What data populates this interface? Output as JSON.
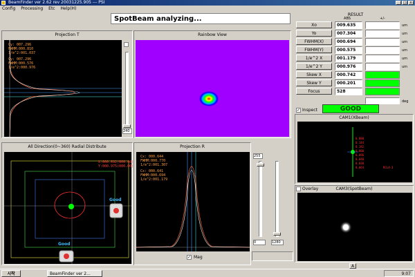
{
  "window": {
    "title": "BeamFinder ver 2.62 rev 20031225.905 --- PSI"
  },
  "menu": [
    "Config",
    "Processing",
    "Etc",
    "Help(H)"
  ],
  "status": "SpotBeam analyzing...",
  "projection_t": {
    "title": "Projection T",
    "readout": [
      "Cy:    007.296",
      "FWHM:000.810",
      "1/e^2:001.037",
      "Cy:    007.296",
      "FWHM:000.576",
      "1/e^2:000.976"
    ],
    "slider_value": "240"
  },
  "rainbow": {
    "title": "Rainbow View"
  },
  "radial": {
    "title": "All Direction(0~360) Radial Distribute",
    "readout": [
      "X:000.692(000.00)",
      "Y:000.975(000.00)"
    ],
    "good_1": "Good",
    "good_2": "Good"
  },
  "projection_r": {
    "title": "Projection R",
    "readout": [
      "Cx:    000.644",
      "FWHM:000.770",
      "1/e^2:001.307",
      "Cx:    000.641",
      "FWHM:000.694",
      "1/e^2:001.179"
    ],
    "mag_label": "Mag"
  },
  "sliders": {
    "top_value": "255",
    "bottom_left": "0",
    "bottom_right": "1280"
  },
  "result": {
    "header": "RESULT",
    "col_abs": "ABS",
    "col_pm": "+/-",
    "rows": [
      {
        "label": "Xo",
        "value": "009.635",
        "unit": "um"
      },
      {
        "label": "Yo",
        "value": "007.304",
        "unit": "um"
      },
      {
        "label": "FWHM(X)",
        "value": "000.694",
        "unit": "um"
      },
      {
        "label": "FWHM(Y)",
        "value": "000.575",
        "unit": "um"
      },
      {
        "label": "1/e^2 X",
        "value": "001.179",
        "unit": "um"
      },
      {
        "label": "1/e^2 Y",
        "value": "000.976",
        "unit": "um"
      },
      {
        "label": "Skew X",
        "value": "000.742",
        "unit": ""
      },
      {
        "label": "Skew Y",
        "value": "000.201",
        "unit": ""
      },
      {
        "label": "Focus",
        "value": "528",
        "unit": ""
      }
    ],
    "deg_unit": "deg",
    "inspect_label": "Inspect",
    "inspect_result": "GOOD"
  },
  "cam1": {
    "title": "CAM1(XBeam)",
    "readout": [
      "0.080",
      "0.144",
      "0.192",
      "0.000",
      "0.096",
      "0.040",
      "0.030",
      "0.064"
    ],
    "side_label": "RCLA-3"
  },
  "cam3": {
    "title": "CAM3(SpotBeam)",
    "overlay_label": "Overlay"
  },
  "bottom_right": {
    "lang": "A"
  },
  "taskbar": {
    "start": "시작",
    "task": "BeamFinder ver 2...",
    "clock": "9:07"
  },
  "colors": {
    "accent": "#0a246a",
    "good": "#00ff00",
    "rainbow_bg": "#a000ff"
  }
}
